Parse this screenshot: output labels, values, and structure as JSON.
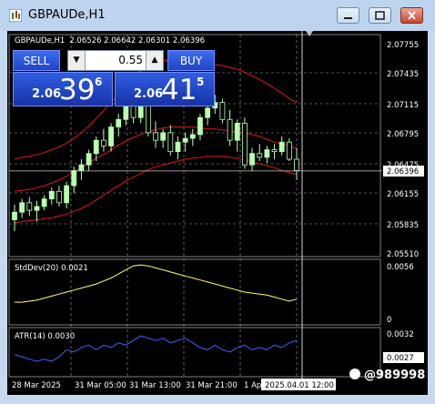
{
  "window": {
    "title": "GBPAUDe,H1"
  },
  "chart_header": {
    "symbol": "GBPAUDe,H1",
    "ohlc": "2.06526 2.06642 2.06301 2.06396"
  },
  "trade_panel": {
    "sell_label": "SELL",
    "buy_label": "BUY",
    "lot": "0.55",
    "sell_prefix": "2.06",
    "sell_big": "39",
    "sell_super": "6",
    "buy_prefix": "2.06",
    "buy_big": "41",
    "buy_super": "5"
  },
  "price_axis": [
    "2.07755",
    "2.07435",
    "2.07115",
    "2.06795",
    "2.06475",
    "2.06155",
    "2.05835",
    "2.05510"
  ],
  "current_price": "2.06396",
  "stddev": {
    "label": "StdDev(20) 0.0021",
    "levels": [
      "0.0056",
      "0"
    ]
  },
  "atr": {
    "label": "ATR(14) 0.0030",
    "levels": [
      "0.0032",
      "0.0027"
    ]
  },
  "time_axis": [
    "28 Mar 2025",
    "31 Mar 05:00",
    "31 Mar 13:00",
    "31 Mar 21:00",
    "1 Ap"
  ],
  "crosshair_time": "2025.04.01 12:00",
  "watermark": "@989998",
  "colors": {
    "bull": "#b8ffb0",
    "band": "#e01818",
    "stddev": "#ffff66",
    "atr": "#3366ff",
    "grid": "#a0a0a0"
  },
  "chart_data": [
    {
      "type": "candlestick",
      "title": "GBPAUDe,H1",
      "ylim": [
        2.0551,
        2.0776
      ],
      "candles": [
        [
          2.0588,
          2.0604,
          2.0576,
          2.0596
        ],
        [
          2.0596,
          2.061,
          2.059,
          2.0606
        ],
        [
          2.0606,
          2.0612,
          2.0592,
          2.0598
        ],
        [
          2.0598,
          2.0608,
          2.0586,
          2.0602
        ],
        [
          2.0602,
          2.0614,
          2.0598,
          2.061
        ],
        [
          2.061,
          2.0622,
          2.0604,
          2.0618
        ],
        [
          2.0618,
          2.0624,
          2.0602,
          2.0606
        ],
        [
          2.0606,
          2.0628,
          2.06,
          2.0624
        ],
        [
          2.0624,
          2.0644,
          2.0616,
          2.064
        ],
        [
          2.064,
          2.0652,
          2.063,
          2.0646
        ],
        [
          2.0646,
          2.0662,
          2.064,
          2.0658
        ],
        [
          2.0658,
          2.0676,
          2.065,
          2.0672
        ],
        [
          2.0672,
          2.0684,
          2.066,
          2.0666
        ],
        [
          2.0666,
          2.069,
          2.066,
          2.0686
        ],
        [
          2.0686,
          2.07,
          2.0676,
          2.0694
        ],
        [
          2.0694,
          2.0714,
          2.0688,
          2.071
        ],
        [
          2.071,
          2.072,
          2.069,
          2.0696
        ],
        [
          2.0696,
          2.0716,
          2.069,
          2.0712
        ],
        [
          2.0712,
          2.0716,
          2.0676,
          2.068
        ],
        [
          2.068,
          2.0692,
          2.0664,
          2.0672
        ],
        [
          2.0672,
          2.0684,
          2.0664,
          2.068
        ],
        [
          2.068,
          2.0688,
          2.0656,
          2.066
        ],
        [
          2.066,
          2.0676,
          2.0652,
          2.067
        ],
        [
          2.067,
          2.068,
          2.066,
          2.0674
        ],
        [
          2.0674,
          2.0684,
          2.0666,
          2.0678
        ],
        [
          2.0678,
          2.07,
          2.0672,
          2.0696
        ],
        [
          2.0696,
          2.0712,
          2.0688,
          2.0706
        ],
        [
          2.0706,
          2.072,
          2.07,
          2.0712
        ],
        [
          2.0712,
          2.0716,
          2.069,
          2.0694
        ],
        [
          2.0694,
          2.0704,
          2.0666,
          2.0672
        ],
        [
          2.0672,
          2.0694,
          2.066,
          2.069
        ],
        [
          2.069,
          2.0696,
          2.0642,
          2.0646
        ],
        [
          2.0646,
          2.0664,
          2.064,
          2.0658
        ],
        [
          2.0658,
          2.0668,
          2.065,
          2.0654
        ],
        [
          2.0654,
          2.0666,
          2.0648,
          2.0662
        ],
        [
          2.0662,
          2.0668,
          2.0652,
          2.066
        ],
        [
          2.066,
          2.0676,
          2.0656,
          2.067
        ],
        [
          2.067,
          2.0674,
          2.065,
          2.0652
        ],
        [
          2.0652,
          2.0664,
          2.063,
          2.064
        ]
      ],
      "band_upper": [
        2.0652,
        2.0654,
        2.0655,
        2.0657,
        2.0659,
        2.0662,
        2.0665,
        2.0669,
        2.0674,
        2.068,
        2.0687,
        2.0695,
        2.0703,
        2.0712,
        2.0721,
        2.073,
        2.0738,
        2.0745,
        2.075,
        2.0754,
        2.0756,
        2.0757,
        2.0757,
        2.0756,
        2.0755,
        2.0754,
        2.0753,
        2.0752,
        2.0751,
        2.0749,
        2.0747,
        2.0744,
        2.074,
        2.0736,
        2.0732,
        2.0727,
        2.0722,
        2.0716,
        2.0712
      ],
      "band_middle": [
        2.0618,
        2.0619,
        2.062,
        2.0622,
        2.0624,
        2.0627,
        2.063,
        2.0634,
        2.0638,
        2.0643,
        2.0648,
        2.0653,
        2.0657,
        2.0662,
        2.0667,
        2.0671,
        2.0675,
        2.0678,
        2.0681,
        2.0683,
        2.0685,
        2.0686,
        2.0686,
        2.0686,
        2.0686,
        2.0685,
        2.0684,
        2.0684,
        2.0683,
        2.0682,
        2.0681,
        2.068,
        2.0678,
        2.0676,
        2.0673,
        2.067,
        2.0668,
        2.0666,
        2.0663
      ],
      "band_lower": [
        2.0585,
        2.0586,
        2.0587,
        2.0588,
        2.0589,
        2.059,
        2.0592,
        2.0594,
        2.0597,
        2.06,
        2.0604,
        2.0609,
        2.0614,
        2.0619,
        2.0624,
        2.0629,
        2.0633,
        2.0637,
        2.0641,
        2.0644,
        2.0646,
        2.0648,
        2.065,
        2.0652,
        2.0653,
        2.0654,
        2.0655,
        2.0655,
        2.0655,
        2.0654,
        2.0653,
        2.0651,
        2.0649,
        2.0647,
        2.0645,
        2.0643,
        2.064,
        2.0638,
        2.0636
      ]
    },
    {
      "type": "line",
      "title": "StdDev(20) 0.0021",
      "ylim": [
        0,
        0.0056
      ],
      "values": [
        0.0018,
        0.0018,
        0.0019,
        0.002,
        0.0022,
        0.0024,
        0.0026,
        0.0028,
        0.003,
        0.0032,
        0.0034,
        0.0036,
        0.0039,
        0.0042,
        0.0046,
        0.005,
        0.0054,
        0.0055,
        0.0054,
        0.0052,
        0.005,
        0.0048,
        0.0046,
        0.0044,
        0.0042,
        0.004,
        0.0038,
        0.0036,
        0.0034,
        0.0032,
        0.003,
        0.0028,
        0.0027,
        0.0026,
        0.0025,
        0.0023,
        0.0021,
        0.0019,
        0.0021
      ]
    },
    {
      "type": "line",
      "title": "ATR(14) 0.0030",
      "ylim": [
        0.0016,
        0.0034
      ],
      "values": [
        0.0024,
        0.0023,
        0.0022,
        0.0021,
        0.0022,
        0.0021,
        0.0023,
        0.0026,
        0.0025,
        0.0027,
        0.0028,
        0.0026,
        0.0028,
        0.0027,
        0.0029,
        0.0028,
        0.003,
        0.0032,
        0.0031,
        0.003,
        0.0031,
        0.0029,
        0.003,
        0.0031,
        0.0029,
        0.0027,
        0.0026,
        0.0028,
        0.0026,
        0.0025,
        0.0027,
        0.0028,
        0.0026,
        0.0027,
        0.0026,
        0.0028,
        0.0027,
        0.0029,
        0.003
      ]
    }
  ]
}
